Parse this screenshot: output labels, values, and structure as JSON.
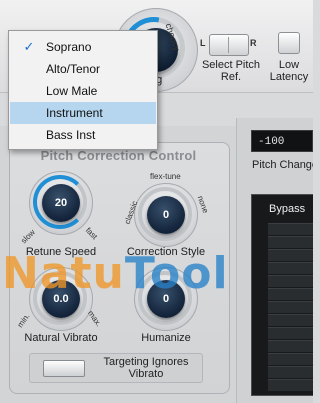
{
  "top": {
    "knob_labels": {
      "upper": "choosy",
      "lower": "ng"
    },
    "switch": {
      "left": "L",
      "right": "R",
      "label": "Select Pitch Ref."
    },
    "latency": {
      "label": "Low Latency"
    }
  },
  "dropdown": {
    "items": [
      {
        "label": "Soprano",
        "checked": true,
        "highlighted": false
      },
      {
        "label": "Alto/Tenor",
        "checked": false,
        "highlighted": false
      },
      {
        "label": "Low Male",
        "checked": false,
        "highlighted": false
      },
      {
        "label": "Instrument",
        "checked": false,
        "highlighted": true
      },
      {
        "label": "Bass Inst",
        "checked": false,
        "highlighted": false
      }
    ],
    "check_glyph": "✓"
  },
  "pitch_correction": {
    "title": "Pitch Correction Control",
    "retune_speed": {
      "value": "20",
      "label": "Retune Speed",
      "min": "slow",
      "max": "fast"
    },
    "correction_style": {
      "value": "0",
      "label": "Correction Style",
      "top": "flex-tune",
      "left": "classic",
      "right": "none"
    },
    "natural_vibrato": {
      "value": "0.0",
      "label": "Natural Vibrato",
      "min": "min.",
      "max": "max."
    },
    "humanize": {
      "value": "0",
      "label": "Humanize"
    },
    "targeting": {
      "label": "Targeting Ignores Vibrato"
    }
  },
  "right": {
    "readout": "-100",
    "pitch_change": "Pitch Change",
    "bypass": "Bypass"
  },
  "watermark": {
    "part1": "Natu",
    "part2": "Tool"
  },
  "colors": {
    "accent": "#1f8fd6",
    "highlight": "#b5d6ee",
    "knob_cap": "#12233a"
  }
}
